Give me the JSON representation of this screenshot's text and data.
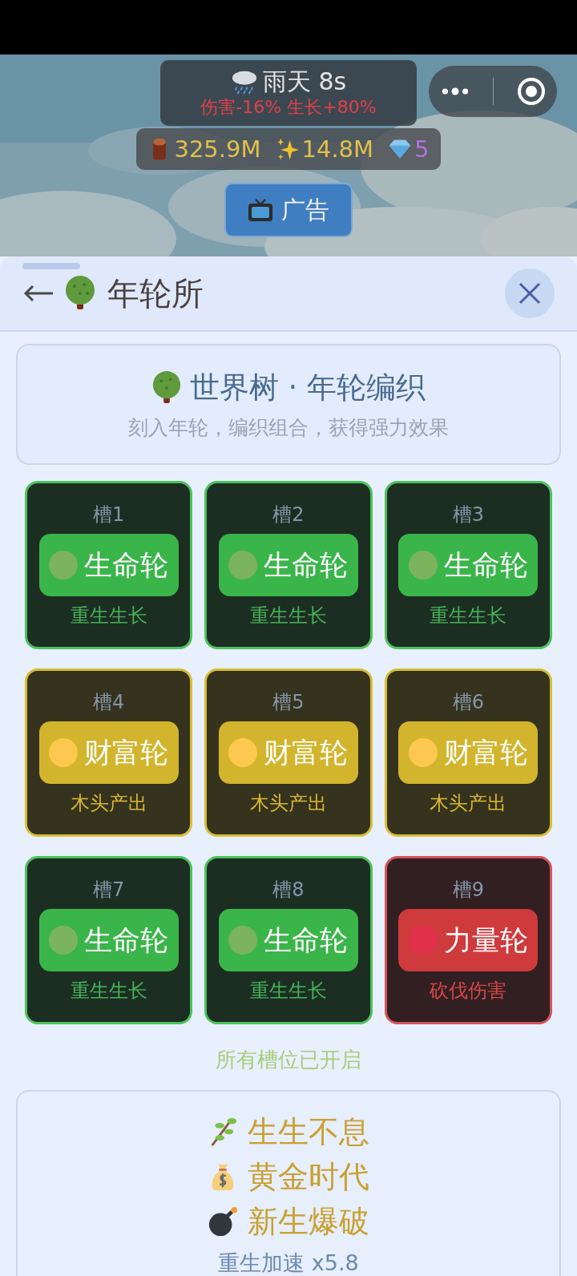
{
  "weather": {
    "label": "雨天 8s",
    "effects": "伤害-16% 生长+80%"
  },
  "resources": [
    {
      "kind": "wood",
      "value": "325.9M"
    },
    {
      "kind": "sparkle",
      "value": "14.8M"
    },
    {
      "kind": "gem",
      "value": "5"
    }
  ],
  "ad_button": {
    "label": "广告"
  },
  "panel": {
    "title": "年轮所"
  },
  "intro": {
    "title": "世界树 · 年轮编织",
    "subtitle": "刻入年轮，编织组合，获得强力效果"
  },
  "slots": [
    {
      "label": "槽1",
      "kind": "life",
      "ring": "生命轮",
      "effect": "重生生长"
    },
    {
      "label": "槽2",
      "kind": "life",
      "ring": "生命轮",
      "effect": "重生生长"
    },
    {
      "label": "槽3",
      "kind": "life",
      "ring": "生命轮",
      "effect": "重生生长"
    },
    {
      "label": "槽4",
      "kind": "wealth",
      "ring": "财富轮",
      "effect": "木头产出"
    },
    {
      "label": "槽5",
      "kind": "wealth",
      "ring": "财富轮",
      "effect": "木头产出"
    },
    {
      "label": "槽6",
      "kind": "wealth",
      "ring": "财富轮",
      "effect": "木头产出"
    },
    {
      "label": "槽7",
      "kind": "life",
      "ring": "生命轮",
      "effect": "重生生长"
    },
    {
      "label": "槽8",
      "kind": "life",
      "ring": "生命轮",
      "effect": "重生生长"
    },
    {
      "label": "槽9",
      "kind": "power",
      "ring": "力量轮",
      "effect": "砍伐伤害"
    }
  ],
  "slots_status": "所有槽位已开启",
  "combos": [
    {
      "kind": "branch",
      "name": "生生不息"
    },
    {
      "kind": "moneybag",
      "name": "黄金时代"
    },
    {
      "kind": "bomb",
      "name": "新生爆破"
    }
  ],
  "bonus": "重生加速 x5.8"
}
